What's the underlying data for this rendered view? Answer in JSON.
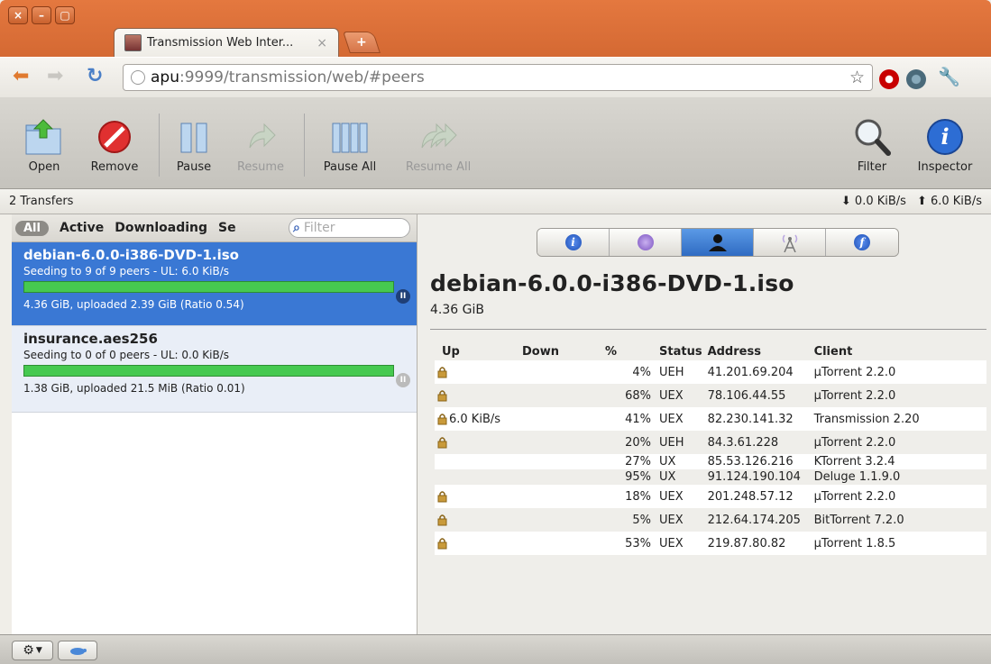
{
  "browser": {
    "tab_title": "Transmission Web Inter...",
    "tab_close": "×",
    "new_tab": "+",
    "url_host": "apu",
    "url_path": ":9999/transmission/web/#peers"
  },
  "toolbar": {
    "open": "Open",
    "remove": "Remove",
    "pause": "Pause",
    "resume": "Resume",
    "pause_all": "Pause All",
    "resume_all": "Resume All",
    "filter": "Filter",
    "inspector": "Inspector"
  },
  "status": {
    "transfers": "2 Transfers",
    "down_speed": "⬇ 0.0 KiB/s",
    "up_speed": "⬆ 6.0 KiB/s"
  },
  "filters": {
    "all": "All",
    "active": "Active",
    "downloading": "Downloading",
    "seeding_partial": "Se",
    "placeholder": "Filter"
  },
  "torrents": [
    {
      "name": "debian-6.0.0-i386-DVD-1.iso",
      "peers": "Seeding to 9 of 9 peers - UL: 6.0 KiB/s",
      "info": "4.36 GiB, uploaded 2.39 GiB (Ratio 0.54)",
      "progress": 1.0
    },
    {
      "name": "insurance.aes256",
      "peers": "Seeding to 0 of 0 peers - UL: 0.0 KiB/s",
      "info": "1.38 GiB, uploaded 21.5 MiB (Ratio 0.01)",
      "progress": 1.0
    }
  ],
  "inspector": {
    "title": "debian-6.0.0-i386-DVD-1.iso",
    "size": "4.36 GiB",
    "headers": {
      "up": "Up",
      "down": "Down",
      "pct": "%",
      "status": "Status",
      "address": "Address",
      "client": "Client"
    },
    "peers": [
      {
        "up": "",
        "down": "",
        "pct": "4%",
        "status": "UEH",
        "address": "41.201.69.204",
        "client": "µTorrent 2.2.0"
      },
      {
        "up": "",
        "down": "",
        "pct": "68%",
        "status": "UEX",
        "address": "78.106.44.55",
        "client": "µTorrent 2.2.0"
      },
      {
        "up": "6.0 KiB/s",
        "down": "",
        "pct": "41%",
        "status": "UEX",
        "address": "82.230.141.32",
        "client": "Transmission 2.20"
      },
      {
        "up": "",
        "down": "",
        "pct": "20%",
        "status": "UEH",
        "address": "84.3.61.228",
        "client": "µTorrent 2.2.0"
      },
      {
        "up": "",
        "down": "",
        "pct": "27%",
        "status": "UX",
        "address": "85.53.126.216",
        "client": "KTorrent 3.2.4"
      },
      {
        "up": "",
        "down": "",
        "pct": "95%",
        "status": "UX",
        "address": "91.124.190.104",
        "client": "Deluge 1.1.9.0"
      },
      {
        "up": "",
        "down": "",
        "pct": "18%",
        "status": "UEX",
        "address": "201.248.57.12",
        "client": "µTorrent 2.2.0"
      },
      {
        "up": "",
        "down": "",
        "pct": "5%",
        "status": "UEX",
        "address": "212.64.174.205",
        "client": "BitTorrent 7.2.0"
      },
      {
        "up": "",
        "down": "",
        "pct": "53%",
        "status": "UEX",
        "address": "219.87.80.82",
        "client": "µTorrent 1.8.5"
      }
    ]
  },
  "colors": {
    "chrome_accent": "#d96a33",
    "selection": "#3a78d4",
    "progress": "#46c950"
  }
}
